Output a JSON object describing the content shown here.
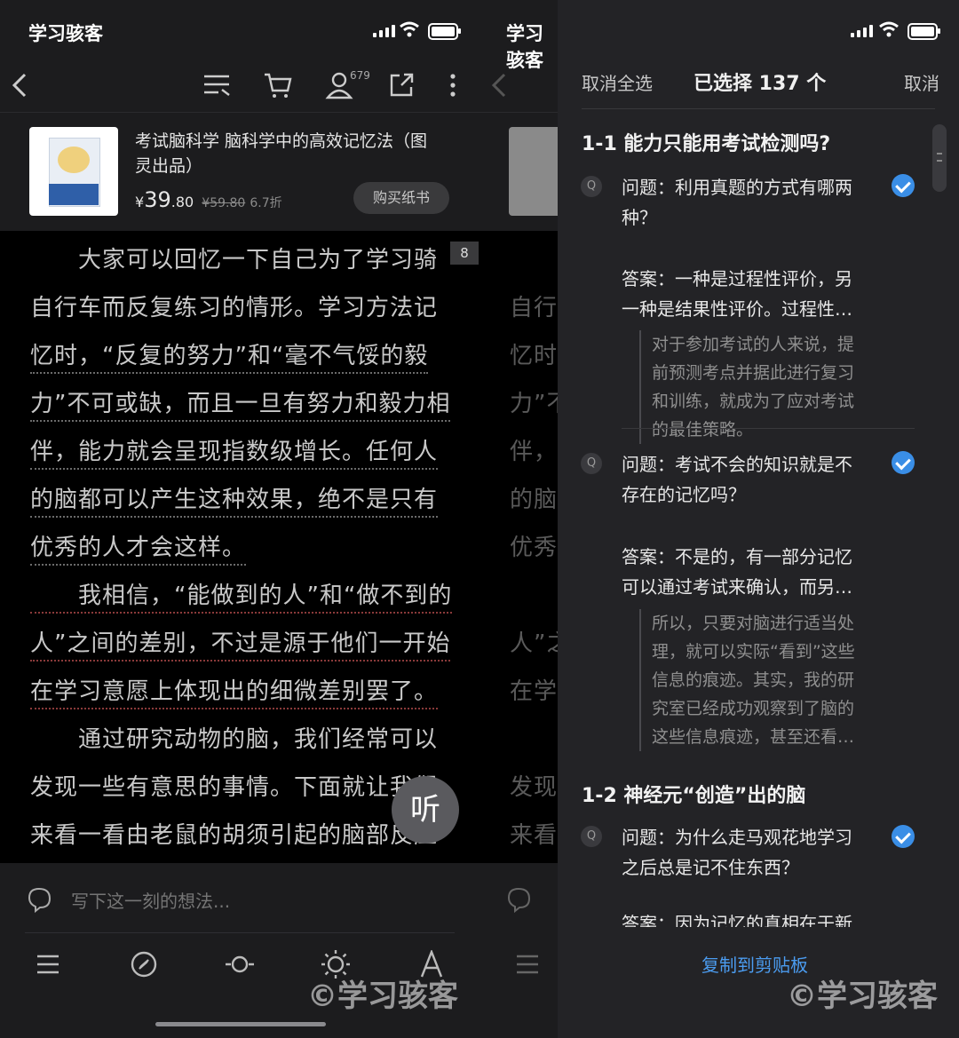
{
  "status_bar": {
    "app_name": "学习骇客"
  },
  "toolbar": {
    "profile_count": "679"
  },
  "book": {
    "title_line1": "考试脑科学 脑科学中的高效记忆法（图",
    "title_line2": "灵出品）",
    "price_symbol": "¥",
    "price_int": "39",
    "price_dec": ".80",
    "original_price": "¥59.80",
    "discount": "6.7折",
    "buy_label": "购买纸书"
  },
  "reader": {
    "page_badge": "8",
    "lines": [
      "　　大家可以回忆一下自己为了学习骑",
      "自行车而反复练习的情形。学习方法记",
      "忆时，“反复的努力”和“毫不气馁的毅",
      "力”不可或缺，而且一旦有努力和毅力相",
      "伴，能力就会呈现指数级增长。任何人",
      "的脑都可以产生这种效果，绝不是只有",
      "优秀的人才会这样。",
      "　　我相信，“能做到的人”和“做不到的",
      "人”之间的差别，不过是源于他们一开始",
      "在学习意愿上体现出的细微差别罢了。",
      "　　通过研究动物的脑，我们经常可以",
      "发现一些有意思的事情。下面就让我们",
      "来看一看由老鼠的胡须引起的脑部反应"
    ],
    "listen_label": "听"
  },
  "comment": {
    "placeholder": "写下这一刻的想法..."
  },
  "mid_fragments": [
    "自行",
    "忆时",
    "力”不",
    "伴，",
    "的脑",
    "优秀",
    "人”之",
    "在学",
    "发现",
    "来看"
  ],
  "selection": {
    "deselect_all": "取消全选",
    "selected_text": "已选择 137 个",
    "cancel": "取消",
    "sections": [
      {
        "title": "1-1 能力只能用考试检测吗?"
      },
      {
        "title": "1-2 神经元“创造”出的脑"
      }
    ],
    "items": [
      {
        "q1": "问题：利用真题的方式有哪两",
        "q2": "种？",
        "a1": "答案：一种是过程性评价，另",
        "a2": "一种是结果性评价。过程性…",
        "n": [
          "对于参加考试的人来说，提",
          "前预测考点并据此进行复习",
          "和训练，就成为了应对考试",
          "的最佳策略。"
        ]
      },
      {
        "q1": "问题：考试不会的知识就是不",
        "q2": "存在的记忆吗？",
        "a1": "答案：不是的，有一部分记忆",
        "a2": "可以通过考试来确认，而另…",
        "n": [
          "所以，只要对脑进行适当处",
          "理，就可以实际“看到”这些",
          "信息的痕迹。其实，我的研",
          "究室已经成功观察到了脑的",
          "这些信息痕迹，甚至还看…"
        ]
      },
      {
        "q1": "问题：为什么走马观花地学习",
        "q2": "之后总是记不住东西？",
        "a1": "答案：因为记忆的真相在于新",
        "a2": ""
      }
    ],
    "copy_label": "复制到剪贴板"
  },
  "watermark": "©学习骇客"
}
